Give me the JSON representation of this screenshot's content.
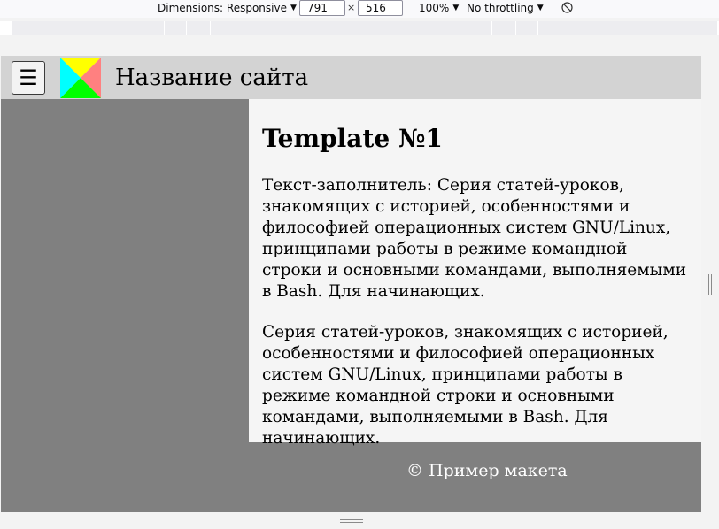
{
  "devtools": {
    "dimensions_label": "Dimensions: Responsive",
    "width_value": "791",
    "times_symbol": "×",
    "height_value": "516",
    "zoom_label": "100%",
    "throttling_label": "No throttling",
    "caret": "▼"
  },
  "site": {
    "menu_icon": "☰",
    "title": "Название сайта",
    "heading": "Template №1",
    "paragraphs": [
      "Текст-заполнитель: Серия статей-уроков, знакомящих с историей, особенностями и философией операционных систем GNU/Linux, принципами работы в режиме командной строки и основными командами, выполняемыми в Bash. Для начинающих.",
      "Серия статей-уроков, знакомящих с историей, особенностями и философией операционных систем GNU/Linux, принципами работы в режиме командной строки и основными командами, выполняемыми в Bash. Для начинающих."
    ],
    "footer": "© Пример макета"
  },
  "colors": {
    "header_bg": "#d3d3d3",
    "sidebar_bg": "#808080",
    "content_bg": "#f5f5f5",
    "logo_colors": [
      "#ffff00",
      "#ff8080",
      "#00ff00",
      "#00ffff"
    ]
  },
  "icons": {
    "menu": "hamburger-icon",
    "logo": "logo-icon",
    "rotate": "rotate-icon"
  }
}
